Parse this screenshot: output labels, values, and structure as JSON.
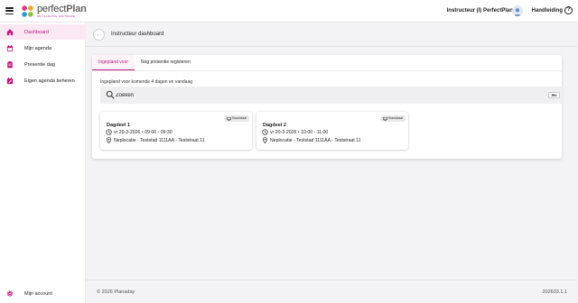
{
  "header": {
    "brand": "perfectPlan",
    "brand_prefix": "perfect",
    "brand_suffix": "Plan",
    "tagline": "DE PLANNING SOFTWARE",
    "user": "Instructeur (I) PerfectPlan",
    "help": "Handleiding",
    "accent": "#c2187a"
  },
  "sidebar": {
    "items": [
      {
        "label": "Dashboard",
        "icon": "home-icon",
        "active": true
      },
      {
        "label": "Mijn agenda",
        "icon": "calendar-icon"
      },
      {
        "label": "Presentie dag",
        "icon": "clipboard-icon"
      },
      {
        "label": "Eigen agenda beheren",
        "icon": "calendar-edit-icon"
      }
    ],
    "account": {
      "label": "Mijn account",
      "icon": "gear-icon"
    }
  },
  "main": {
    "title": "Instructeur dashboard",
    "tabs": [
      {
        "label": "Ingepland voor",
        "active": true
      },
      {
        "label": "Nog presentie registeren",
        "active": false
      }
    ],
    "subtitle": "Ingepland voor komende 4 dagen en vandaag",
    "search": {
      "placeholder": "Zoeken",
      "shortcut": "⌘K"
    },
    "items": [
      {
        "title": "Dagdeel 1",
        "badge": "Klaslokaal",
        "datetime": "vr 20-3-2026 • 09:00 - 09:30",
        "location": "Neplocatie - Teststad 1111AA - Teststraat 11"
      },
      {
        "title": "Dagdeel 2",
        "badge": "Klaslokaal",
        "datetime": "vr 20-3-2026 • 10:00 - 11:00",
        "location": "Neplocatie - Teststad 1111AA - Teststraat 11"
      }
    ]
  },
  "footer": {
    "copyright": "© 2026 Planaday",
    "version": "202603.1.1"
  }
}
